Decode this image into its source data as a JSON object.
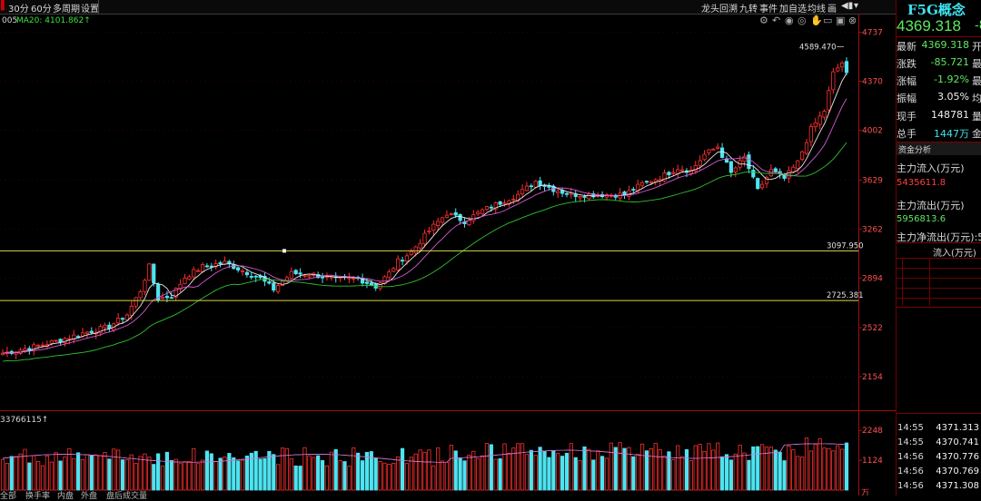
{
  "toolbar": {
    "left_items": [
      "30分",
      "60分",
      "多周期",
      "设置"
    ],
    "right_items": [
      "龙头回溯",
      "九转",
      "事件",
      "加自选",
      "均线",
      "画"
    ]
  },
  "indicator": {
    "prefix": "005",
    "ma20": "MA20: 4101.862↑",
    "volume_prefix": "33766115↑"
  },
  "chart_data": [
    {
      "type": "candlestick",
      "title": "",
      "ylim": [
        1950,
        4830
      ],
      "y_ticks": [
        4737,
        4370,
        4002,
        3629,
        3262,
        2894,
        2522,
        2154
      ],
      "y_tick_labels": [
        "4737",
        "4370",
        "4002",
        "3629",
        "3262",
        "2894",
        "2522",
        "2154"
      ],
      "colors": {
        "up": "#ff3030",
        "down": "#4fe3f0",
        "ma1": "#e8e8e8",
        "ma2": "#d75ad7",
        "ma3": "#2ec22e",
        "hline": "#d8d84a"
      },
      "annotations": [
        {
          "text": "4589.470",
          "value": 4589.47
        },
        {
          "text": "3097.950",
          "value": 3097.95
        },
        {
          "text": "2725.381",
          "value": 2725.381
        }
      ],
      "hlines": [
        3097.95,
        2725.381
      ],
      "anchor_closes": [
        [
          0,
          2330
        ],
        [
          6,
          2370
        ],
        [
          12,
          2420
        ],
        [
          18,
          2480
        ],
        [
          24,
          2530
        ],
        [
          28,
          2620
        ],
        [
          31,
          2800
        ],
        [
          33,
          2980
        ],
        [
          35,
          2740
        ],
        [
          38,
          2760
        ],
        [
          41,
          2900
        ],
        [
          45,
          2980
        ],
        [
          50,
          3010
        ],
        [
          54,
          2950
        ],
        [
          58,
          2890
        ],
        [
          61,
          2810
        ],
        [
          65,
          2930
        ],
        [
          70,
          2920
        ],
        [
          75,
          2880
        ],
        [
          80,
          2890
        ],
        [
          84,
          2830
        ],
        [
          87,
          2930
        ],
        [
          89,
          3020
        ],
        [
          92,
          3090
        ],
        [
          96,
          3250
        ],
        [
          100,
          3380
        ],
        [
          104,
          3320
        ],
        [
          108,
          3400
        ],
        [
          112,
          3460
        ],
        [
          116,
          3520
        ],
        [
          120,
          3620
        ],
        [
          124,
          3560
        ],
        [
          128,
          3520
        ],
        [
          134,
          3520
        ],
        [
          140,
          3520
        ],
        [
          144,
          3600
        ],
        [
          148,
          3650
        ],
        [
          152,
          3720
        ],
        [
          155,
          3700
        ],
        [
          158,
          3820
        ],
        [
          161,
          3880
        ],
        [
          164,
          3680
        ],
        [
          167,
          3800
        ],
        [
          170,
          3550
        ],
        [
          173,
          3700
        ],
        [
          176,
          3640
        ],
        [
          179,
          3760
        ],
        [
          182,
          4010
        ],
        [
          185,
          4150
        ],
        [
          187,
          4430
        ],
        [
          189,
          4510
        ],
        [
          190,
          4420
        ]
      ],
      "num_candles": 191
    },
    {
      "type": "bar",
      "title": "",
      "ylim": [
        0,
        2700
      ],
      "y_ticks": [
        2248,
        1124
      ],
      "y_tick_labels": [
        "2248",
        "1124"
      ],
      "unit": "万",
      "num_bars": 191
    }
  ],
  "quote": {
    "name": "F5G概念",
    "price": "4369.318",
    "price_cut": "-8",
    "fields": [
      {
        "label": "最新",
        "value": "4369.318",
        "cut": "开",
        "color": "#5fe85f"
      },
      {
        "label": "涨跌",
        "value": "-85.721",
        "cut": "最",
        "color": "#5fe85f"
      },
      {
        "label": "涨幅",
        "value": "-1.92%",
        "cut": "最",
        "color": "#5fe85f"
      },
      {
        "label": "振幅",
        "value": "3.05%",
        "cut": "均",
        "color": "#f0f0f0"
      },
      {
        "label": "现手",
        "value": "148781",
        "cut": "量",
        "color": "#f0f0f0"
      },
      {
        "label": "总手",
        "value": "1447万",
        "cut": "金",
        "color": "#f0f0f0"
      }
    ]
  },
  "fund_flow": {
    "title": "资金分析",
    "inflow_label": "主力流入(万元)",
    "inflow_value": "5435611.8",
    "outflow_label": "主力流出(万元)",
    "outflow_value": "5956813.6",
    "net_label": "主力净流出(万元):5",
    "col_header": "流入(万元)"
  },
  "ticks": [
    {
      "time": "14:55",
      "price": "4371.313"
    },
    {
      "time": "14:55",
      "price": "4370.741"
    },
    {
      "time": "14:56",
      "price": "4370.776"
    },
    {
      "time": "14:56",
      "price": "4370.769"
    },
    {
      "time": "14:56",
      "price": "4371.308"
    }
  ],
  "bottom_tabs": [
    "全部",
    "换手率",
    "内盘",
    "外盘",
    "盘后成交量"
  ]
}
